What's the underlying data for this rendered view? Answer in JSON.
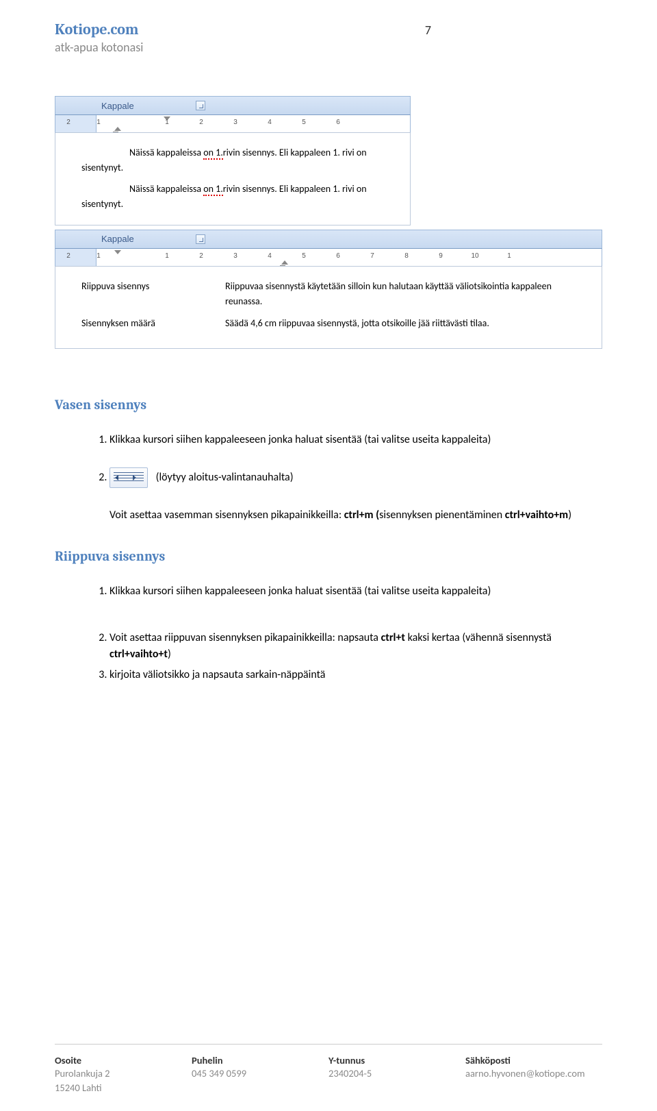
{
  "header": {
    "brand": "Kotiope.com",
    "tagline": "atk-apua kotonasi",
    "page_number": "7"
  },
  "screenshot1": {
    "ribbon_label": "Kappale",
    "ruler_numbers": [
      "2",
      "1",
      "",
      "1",
      "2",
      "3",
      "4",
      "5",
      "6"
    ],
    "para1_a": "Näissä kappaleissa ",
    "para1_squiggle": "on 1.",
    "para1_b": "rivin sisennys. Eli kappaleen 1. rivi on sisentynyt.",
    "para2_a": "Näissä kappaleissa ",
    "para2_squiggle": "on 1.",
    "para2_b": "rivin sisennys. Eli kappaleen 1. rivi on sisentynyt."
  },
  "screenshot2": {
    "ribbon_label": "Kappale",
    "ruler_numbers": [
      "2",
      "1",
      "",
      "1",
      "2",
      "3",
      "4",
      "5",
      "6",
      "7",
      "8",
      "9",
      "10",
      "1"
    ],
    "row1_label": "Riippuva sisennys",
    "row1_body": "Riippuvaa sisennystä käytetään silloin kun halutaan käyttää väliotsikointia kappaleen reunassa.",
    "row2_label": "Sisennyksen määrä",
    "row2_body": "Säädä 4,6 cm riippuvaa sisennystä, jotta otsikoille jää riittävästi tilaa."
  },
  "section1": {
    "heading": "Vasen sisennys",
    "step1": "Klikkaa kursori siihen kappaleeseen jonka haluat sisentää (tai valitse useita kappaleita)",
    "step2_suffix": " (löytyy aloitus-valintanauhalta)",
    "body_a": "Voit asettaa vasemman sisennyksen pikapainikkeilla: ",
    "body_kbd1": "ctrl+m  (",
    "body_b": "sisennyksen pienentäminen ",
    "body_kbd2": "ctrl+vaihto+m",
    "body_c": ")"
  },
  "section2": {
    "heading": "Riippuva sisennys",
    "step1": "Klikkaa kursori siihen kappaleeseen jonka haluat sisentää (tai valitse useita kappaleita)",
    "step2_a": "Voit asettaa riippuvan sisennyksen  pikapainikkeilla: napsauta ",
    "step2_kbd1": "ctrl+t",
    "step2_b": " kaksi kertaa (vähennä sisennystä ",
    "step2_kbd2": "ctrl+vaihto+t",
    "step2_c": ")",
    "step3": "kirjoita väliotsikko ja napsauta sarkain-näppäintä"
  },
  "footer": {
    "col1_head": "Osoite",
    "col1_body1": "Purolankuja 2",
    "col1_body2": "15240 Lahti",
    "col2_head": "Puhelin",
    "col2_body": "045 349 0599",
    "col3_head": "Y-tunnus",
    "col3_body": "2340204-5",
    "col4_head": "Sähköposti",
    "col4_body": "aarno.hyvonen@kotiope.com"
  }
}
